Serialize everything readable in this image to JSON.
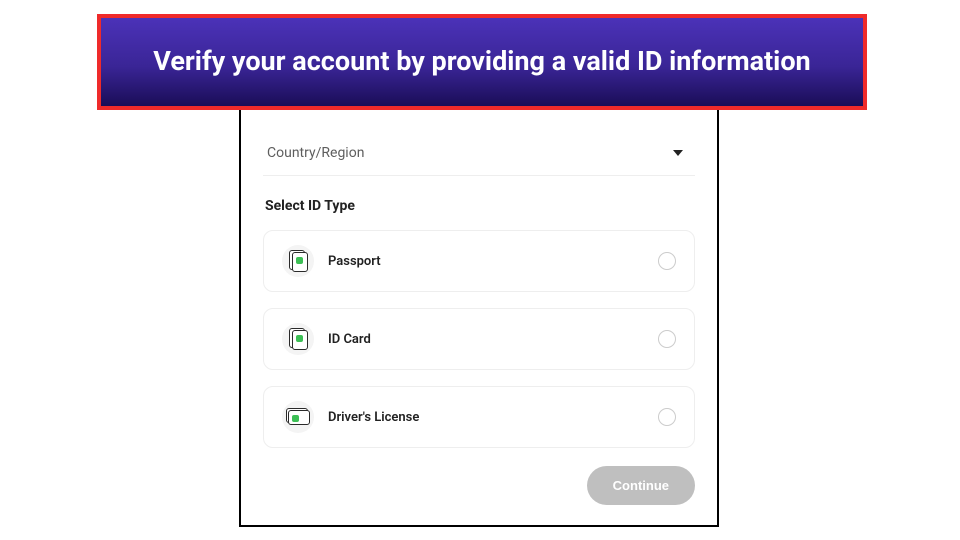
{
  "banner": {
    "text": "Verify your account by providing a valid ID information"
  },
  "form": {
    "country_label": "Country/Region",
    "section_label": "Select ID Type",
    "options": [
      {
        "label": "Passport"
      },
      {
        "label": "ID Card"
      },
      {
        "label": "Driver's License"
      }
    ],
    "continue_label": "Continue"
  },
  "colors": {
    "banner_border": "#ef2a2a",
    "banner_bg_top": "#4b32b8",
    "banner_bg_bottom": "#1a0d57",
    "accent_green": "#3cbf55"
  }
}
